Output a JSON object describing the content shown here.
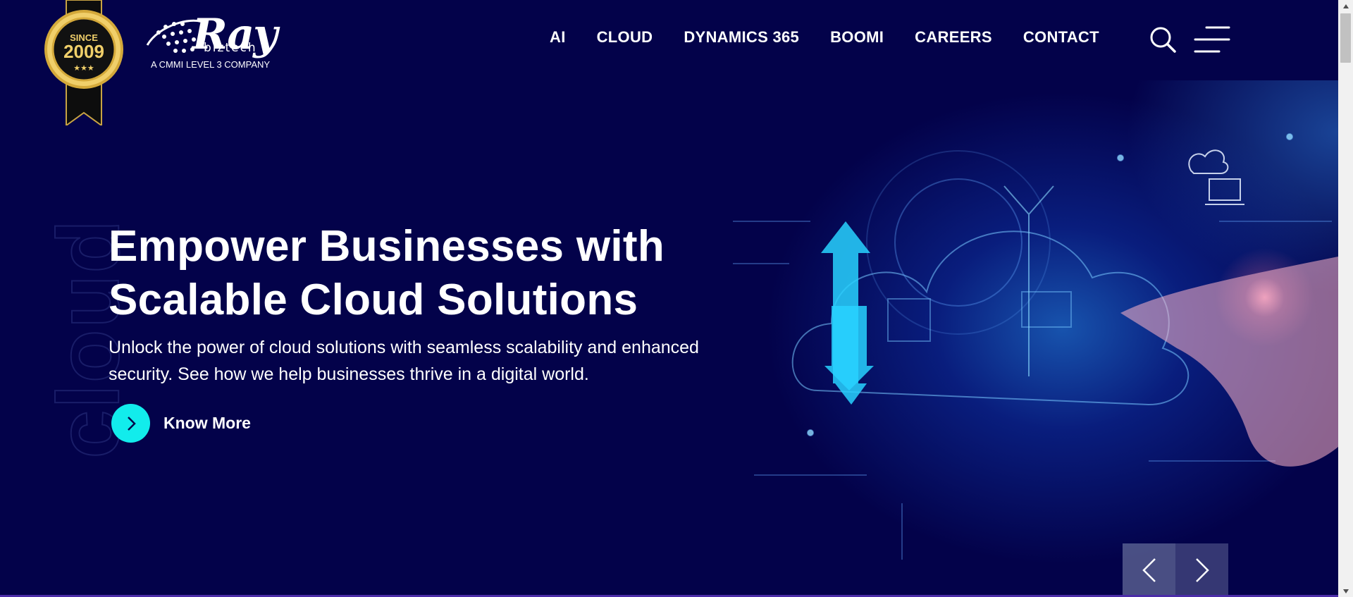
{
  "header": {
    "badge": {
      "top_text": "SINCE",
      "year": "2009",
      "stars": "★★★"
    },
    "logo": {
      "wordmark": "Ray",
      "sub": "biztech",
      "tagline": "A CMMI LEVEL 3 COMPANY"
    },
    "nav": [
      {
        "label": "AI"
      },
      {
        "label": "CLOUD"
      },
      {
        "label": "DYNAMICS 365"
      },
      {
        "label": "BOOMI"
      },
      {
        "label": "CAREERS"
      },
      {
        "label": "CONTACT"
      }
    ],
    "icons": {
      "search": "search-icon",
      "menu": "hamburger-menu-icon"
    }
  },
  "hero": {
    "vertical_word": "cloud",
    "headline_line1": "Empower Businesses with",
    "headline_line2": "Scalable Cloud Solutions",
    "subtext_line1": "Unlock the power of cloud solutions with seamless scalability and enhanced",
    "subtext_line2": "security. See how we help businesses thrive in a digital world.",
    "cta_label": "Know More",
    "slider": {
      "prev_icon": "chevron-left-icon",
      "next_icon": "chevron-right-icon"
    }
  },
  "colors": {
    "background": "#03024a",
    "accent": "#12ecec",
    "text": "#ffffff",
    "badge_gold": "#d4a93a"
  }
}
